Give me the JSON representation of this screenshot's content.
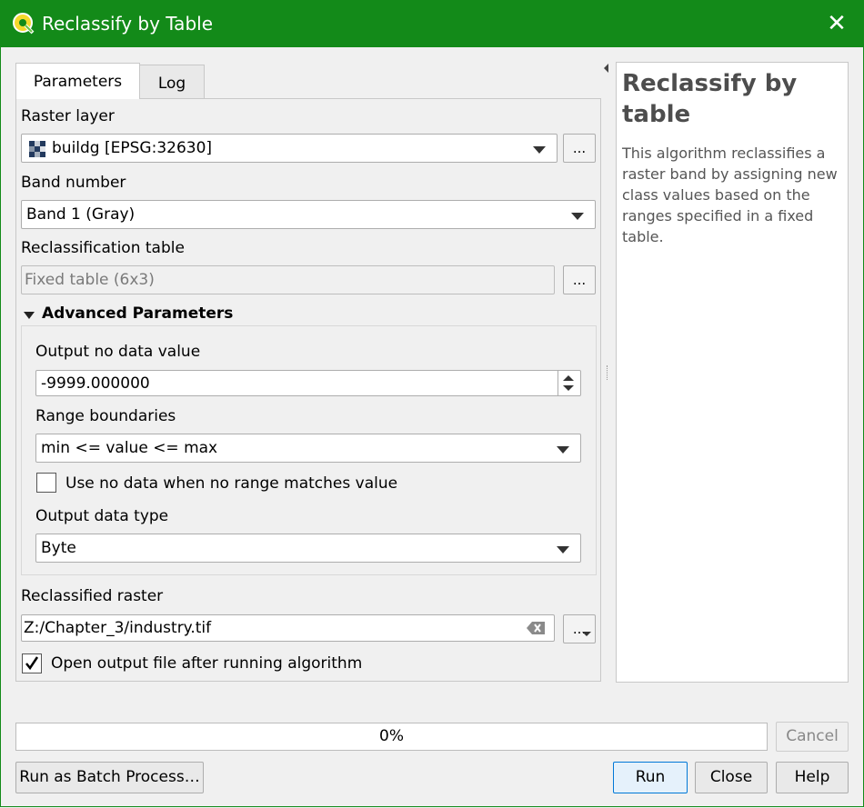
{
  "window": {
    "title": "Reclassify by Table",
    "close_glyph": "✕"
  },
  "tabs": [
    {
      "label": "Parameters"
    },
    {
      "label": "Log"
    }
  ],
  "raster_layer": {
    "label": "Raster layer",
    "value": "buildg [EPSG:32630]"
  },
  "band_number": {
    "label": "Band number",
    "value": "Band 1 (Gray)"
  },
  "reclass_table": {
    "label": "Reclassification table",
    "value": "Fixed table (6x3)"
  },
  "advanced": {
    "title": "Advanced Parameters",
    "nodata": {
      "label": "Output no data value",
      "value": "-9999.000000"
    },
    "range": {
      "label": "Range boundaries",
      "value": "min <= value <= max"
    },
    "use_nodata": {
      "label": "Use no data when no range matches value",
      "checked": false
    },
    "data_type": {
      "label": "Output data type",
      "value": "Byte"
    }
  },
  "output": {
    "label": "Reclassified raster",
    "value": "Z:/Chapter_3/industry.tif",
    "browse_label": "..."
  },
  "open_output": {
    "label": "Open output file after running algorithm",
    "checked": true
  },
  "help": {
    "title": "Reclassify by table",
    "text": "This algorithm reclassifies a raster band by assigning new class values based on the ranges specified in a fixed table."
  },
  "progress": {
    "value": 0,
    "text": "0%"
  },
  "buttons": {
    "cancel": "Cancel",
    "batch": "Run as Batch Process…",
    "run": "Run",
    "close": "Close",
    "help": "Help",
    "dots": "..."
  },
  "colors": {
    "titlebar": "#138a19",
    "background": "#f0f0f0"
  }
}
